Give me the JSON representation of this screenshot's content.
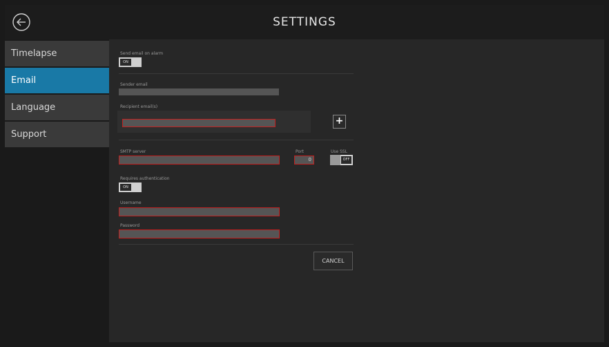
{
  "header": {
    "title": "SETTINGS"
  },
  "sidebar": {
    "items": [
      {
        "label": "Timelapse",
        "active": false
      },
      {
        "label": "Email",
        "active": true
      },
      {
        "label": "Language",
        "active": false
      },
      {
        "label": "Support",
        "active": false
      }
    ]
  },
  "form": {
    "send_email_label": "Send email on alarm",
    "send_email_toggle": "ON",
    "sender_email_label": "Sender email",
    "sender_email_value": "",
    "recipient_label": "Recipient email(s)",
    "recipient_value": "",
    "add_recipient_label": "+",
    "smtp_label": "SMTP server",
    "smtp_value": "",
    "port_label": "Port",
    "port_value": "0",
    "ssl_label": "Use SSL",
    "ssl_toggle": "OFF",
    "auth_label": "Requires authentication",
    "auth_toggle": "ON",
    "username_label": "Username",
    "username_value": "",
    "password_label": "Password",
    "password_value": "",
    "cancel_label": "CANCEL"
  },
  "colors": {
    "accent": "#1979a6",
    "error_border": "#c2201f"
  },
  "icons": {
    "back": "back-arrow-circle-icon"
  }
}
